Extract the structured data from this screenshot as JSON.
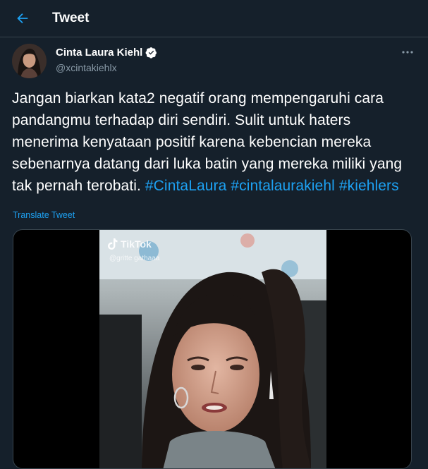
{
  "header": {
    "title": "Tweet",
    "back_icon": "arrow-left-icon"
  },
  "author": {
    "display_name": "Cinta Laura Kiehl",
    "handle": "@xcintakiehlx",
    "verified_icon": "verified-badge-icon"
  },
  "tweet": {
    "text": "Jangan biarkan kata2 negatif orang mempengaruhi cara pandangmu terhadap diri sendiri. Sulit untuk haters menerima kenyataan positif karena kebencian mereka sebenarnya datang dari luka batin yang mereka miliki yang tak pernah terobati.",
    "hashtags": [
      "#CintaLaura",
      "#cintalaurakiehl",
      "#kiehlers"
    ],
    "translate_label": "Translate Tweet"
  },
  "media": {
    "watermark_brand": "TikTok",
    "watermark_user": "@gritte gathaaa"
  },
  "colors": {
    "background": "#15202b",
    "accent": "#1da1f2",
    "secondary_text": "#8899a6",
    "border": "#38444d"
  }
}
